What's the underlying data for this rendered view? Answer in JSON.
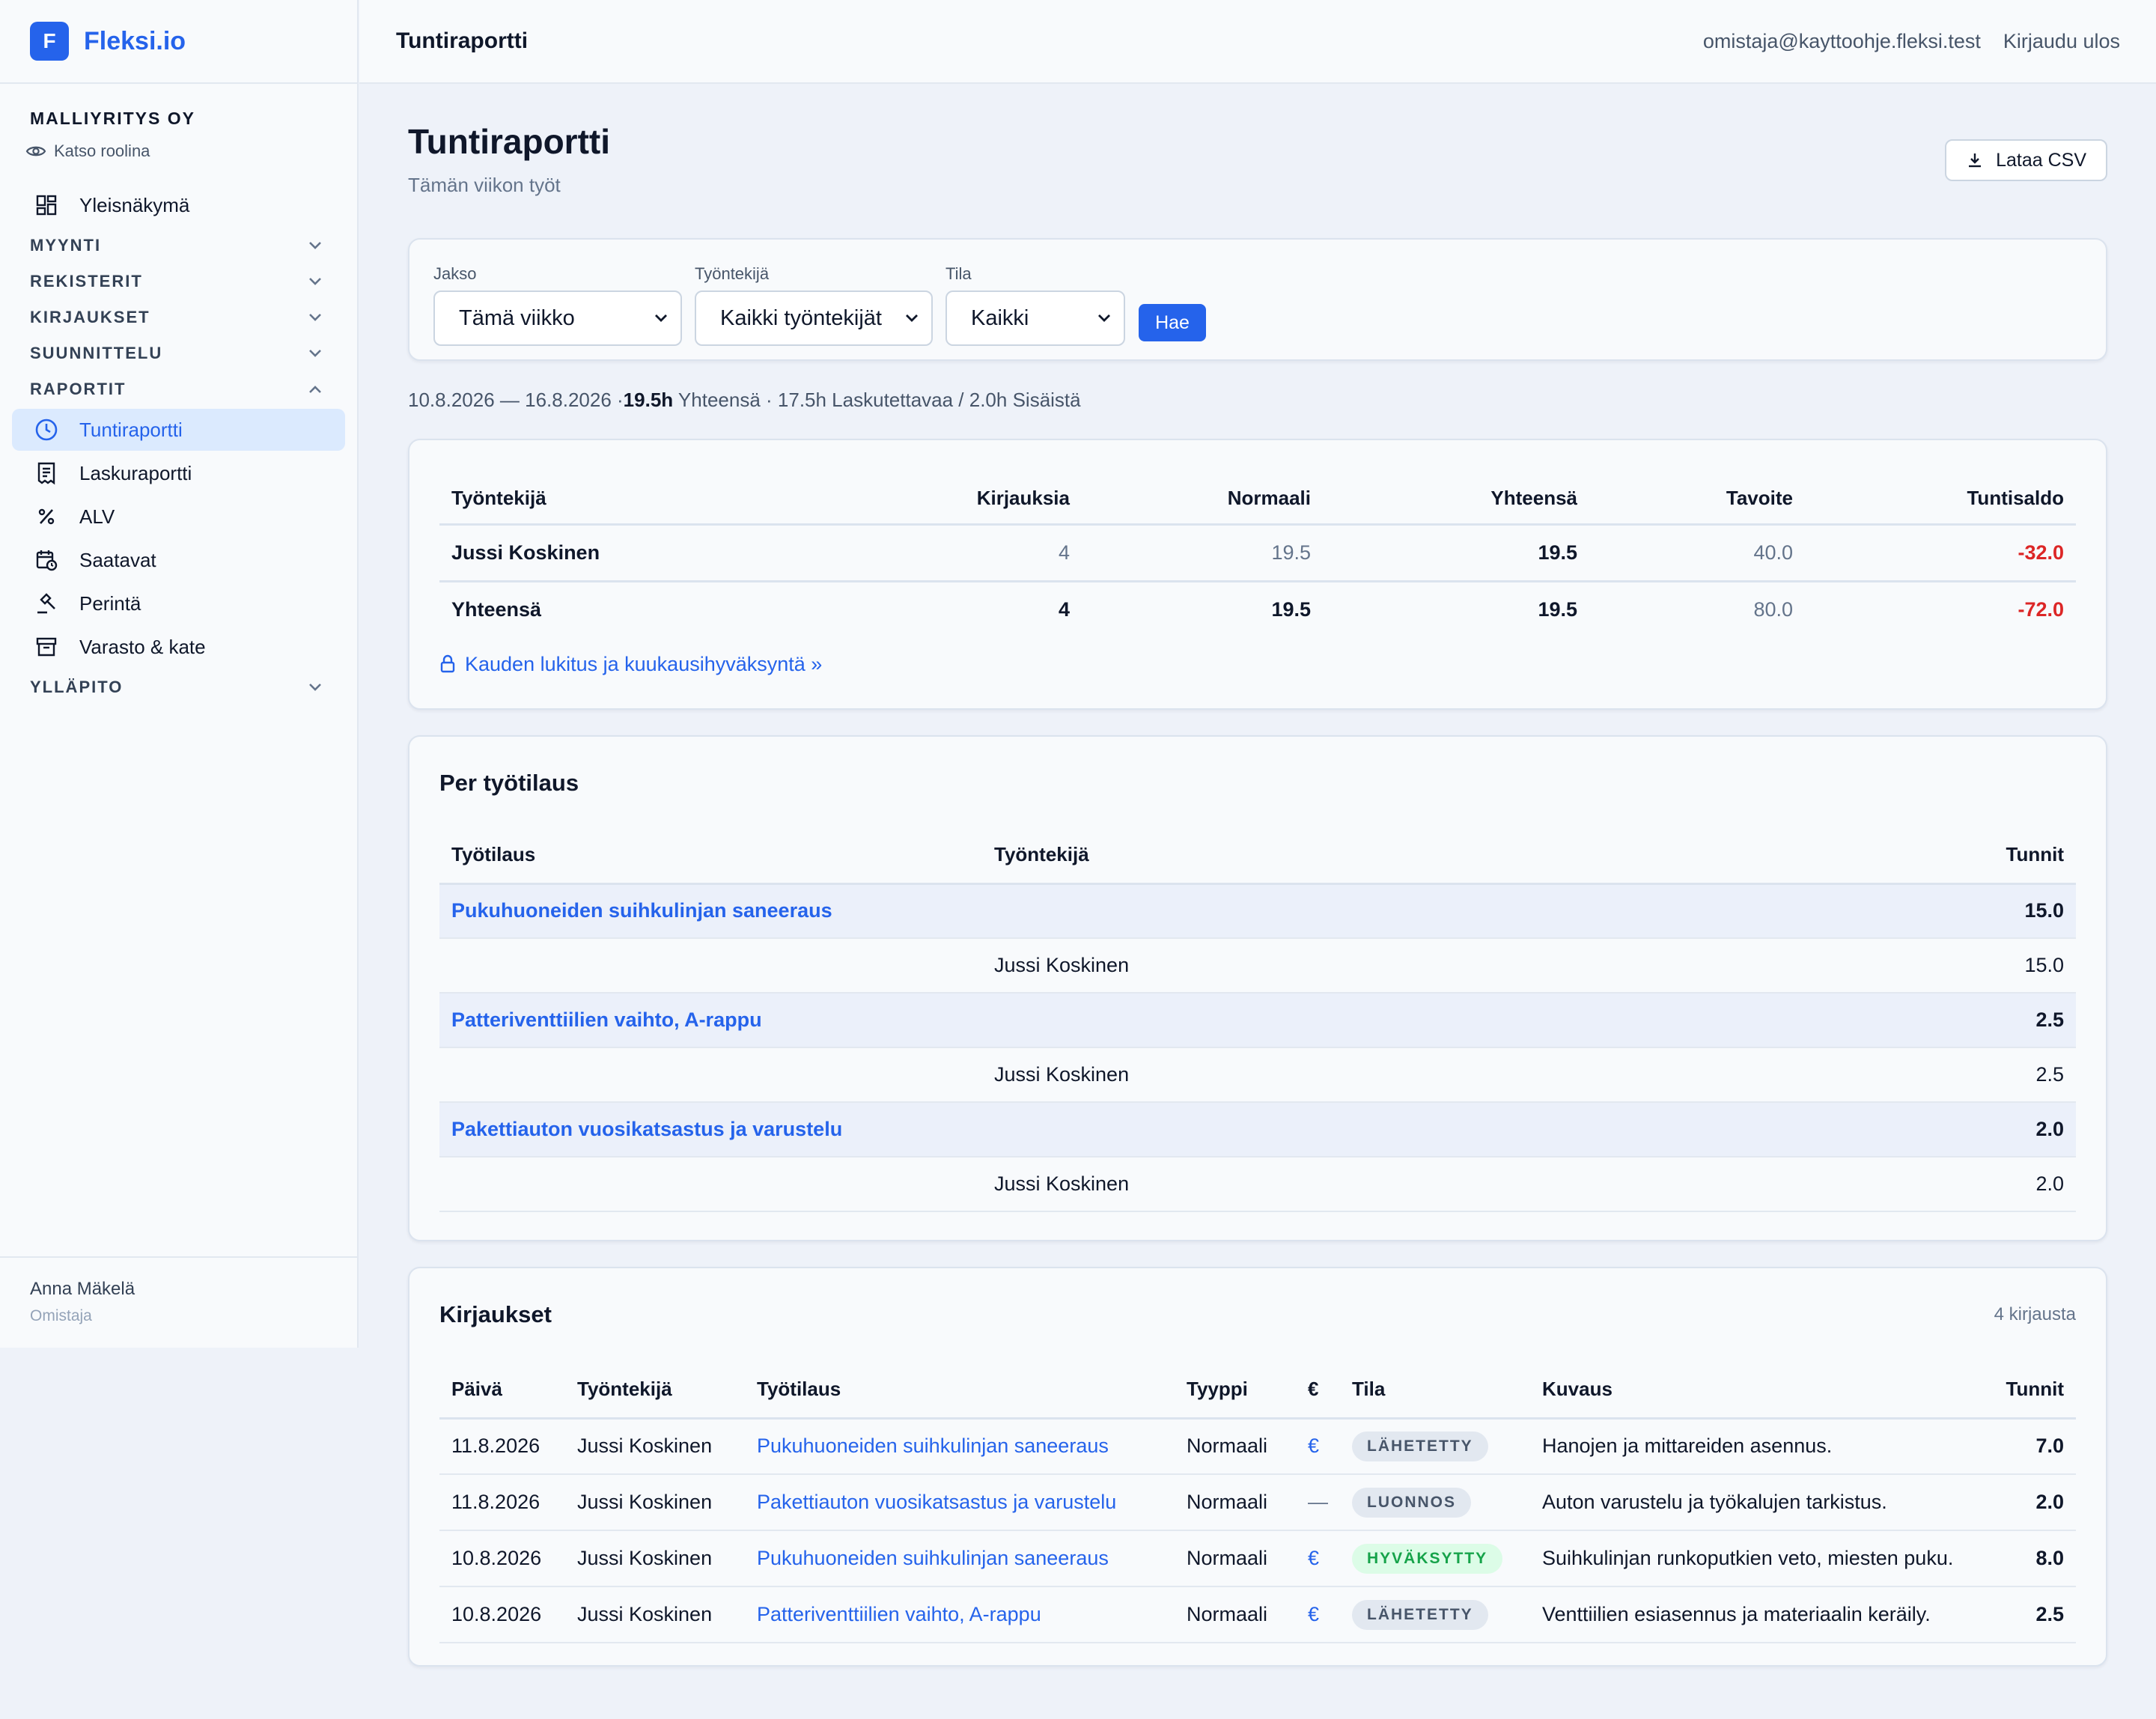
{
  "app": {
    "logo_letter": "F",
    "name": "Fleksi.io"
  },
  "company": {
    "name": "MALLIYRITYS OY",
    "view_role": "Katso roolina"
  },
  "nav": {
    "overview": "Yleisnäkymä",
    "groups": {
      "sales": "MYYNTI",
      "registers": "REKISTERIT",
      "entries": "KIRJAUKSET",
      "planning": "SUUNNITTELU",
      "reports": "RAPORTIT",
      "maintenance": "YLLÄPITO"
    },
    "report_items": [
      "Tuntiraportti",
      "Laskuraportti",
      "ALV",
      "Saatavat",
      "Perintä",
      "Varasto & kate"
    ]
  },
  "user": {
    "name": "Anna Mäkelä",
    "role": "Omistaja"
  },
  "topbar": {
    "title": "Tuntiraportti",
    "email": "omistaja@kayttoohje.fleksi.test",
    "logout": "Kirjaudu ulos"
  },
  "page": {
    "title": "Tuntiraportti",
    "subtitle": "Tämän viikon työt",
    "csv_label": "Lataa CSV"
  },
  "filters": {
    "period_label": "Jakso",
    "period_value": "Tämä viikko",
    "employee_label": "Työntekijä",
    "employee_value": "Kaikki työntekijät",
    "status_label": "Tila",
    "status_value": "Kaikki",
    "search_label": "Hae"
  },
  "summary": {
    "range": "10.8.2026 — 16.8.2026 · ",
    "total_hours": "19.5h",
    "rest": " Yhteensä · 17.5h Laskutettavaa / 2.0h Sisäistä"
  },
  "employee_table": {
    "headers": [
      "Työntekijä",
      "Kirjauksia",
      "Normaali",
      "Yhteensä",
      "Tavoite",
      "Tuntisaldo"
    ],
    "row": {
      "name": "Jussi Koskinen",
      "entries": "4",
      "normal": "19.5",
      "total": "19.5",
      "target": "40.0",
      "balance": "-32.0"
    },
    "total_row": {
      "name": "Yhteensä",
      "entries": "4",
      "normal": "19.5",
      "total": "19.5",
      "target": "80.0",
      "balance": "-72.0"
    },
    "lock_link": "Kauden lukitus ja kuukausihyväksyntä »"
  },
  "per_order": {
    "title": "Per työtilaus",
    "headers": [
      "Työtilaus",
      "Työntekijä",
      "Tunnit"
    ],
    "orders": [
      {
        "name": "Pukuhuoneiden suihkulinjan saneeraus",
        "hours": "15.0",
        "employee": "Jussi Koskinen",
        "employee_hours": "15.0"
      },
      {
        "name": "Patteriventtiilien vaihto, A-rappu",
        "hours": "2.5",
        "employee": "Jussi Koskinen",
        "employee_hours": "2.5"
      },
      {
        "name": "Pakettiauton vuosikatsastus ja varustelu",
        "hours": "2.0",
        "employee": "Jussi Koskinen",
        "employee_hours": "2.0"
      }
    ]
  },
  "entries": {
    "title": "Kirjaukset",
    "count": "4 kirjausta",
    "headers": [
      "Päivä",
      "Työntekijä",
      "Työtilaus",
      "Tyyppi",
      "€",
      "Tila",
      "Kuvaus",
      "Tunnit"
    ],
    "rows": [
      {
        "date": "11.8.2026",
        "employee": "Jussi Koskinen",
        "order": "Pukuhuoneiden suihkulinjan saneeraus",
        "type": "Normaali",
        "billable": "€",
        "status": "LÄHETETTY",
        "description": "Hanojen ja mittareiden asennus.",
        "hours": "7.0"
      },
      {
        "date": "11.8.2026",
        "employee": "Jussi Koskinen",
        "order": "Pakettiauton vuosikatsastus ja varustelu",
        "type": "Normaali",
        "billable": "—",
        "status": "LUONNOS",
        "description": "Auton varustelu ja työkalujen tarkistus.",
        "hours": "2.0"
      },
      {
        "date": "10.8.2026",
        "employee": "Jussi Koskinen",
        "order": "Pukuhuoneiden suihkulinjan saneeraus",
        "type": "Normaali",
        "billable": "€",
        "status": "HYVÄKSYTTY",
        "description": "Suihkulinjan runkoputkien veto, miesten puku.",
        "hours": "8.0"
      },
      {
        "date": "10.8.2026",
        "employee": "Jussi Koskinen",
        "order": "Patteriventtiilien vaihto, A-rappu",
        "type": "Normaali",
        "billable": "€",
        "status": "LÄHETETTY",
        "description": "Venttiilien esiasennus ja materiaalin keräily.",
        "hours": "2.5"
      }
    ]
  }
}
